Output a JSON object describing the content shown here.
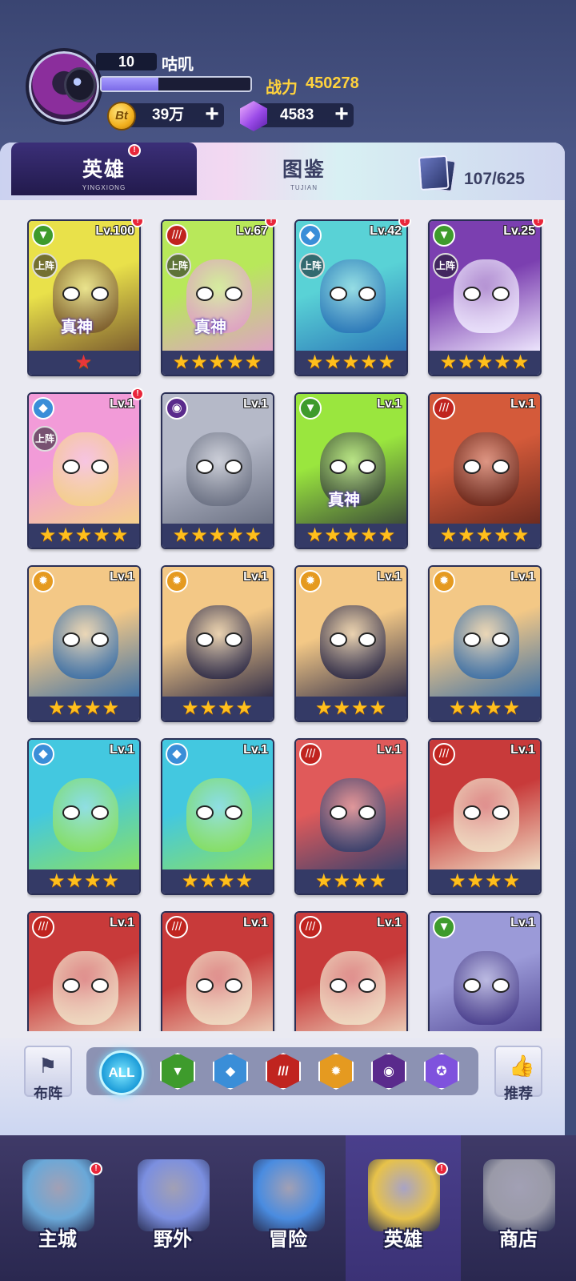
{
  "player": {
    "level": "10",
    "name": "咕叽",
    "xp_fraction": 0.38,
    "power_label": "战力",
    "power_value": "450278",
    "coins": "39万",
    "gems": "4583",
    "coin_icon_text": "Bt"
  },
  "tabs": {
    "heroes_title": "英雄",
    "heroes_sub": "YINGXIONG",
    "atlas_title": "图鉴",
    "atlas_sub": "TUJIAN",
    "collection": "107/625"
  },
  "badges": {
    "alert": "!"
  },
  "labels": {
    "deployed": "上阵",
    "true_god": "真神"
  },
  "heroes": [
    {
      "level": "Lv.100",
      "faction": "green",
      "stars": "★",
      "deployed": true,
      "true_god": true,
      "alert": true,
      "bg": [
        "#e9e14a",
        "#7a5a2e"
      ]
    },
    {
      "level": "Lv.67",
      "faction": "red",
      "stars": "★★★★★",
      "deployed": true,
      "true_god": true,
      "alert": true,
      "bg": [
        "#b8e85a",
        "#e0a0c8"
      ]
    },
    {
      "level": "Lv.42",
      "faction": "blue",
      "stars": "★★★★★",
      "deployed": true,
      "true_god": false,
      "alert": true,
      "bg": [
        "#59d2d6",
        "#2c76b8"
      ]
    },
    {
      "level": "Lv.25",
      "faction": "green",
      "stars": "★★★★★",
      "deployed": true,
      "true_god": false,
      "alert": true,
      "bg": [
        "#7b3fb0",
        "#f0eaff"
      ]
    },
    {
      "level": "Lv.1",
      "faction": "blue",
      "stars": "★★★★★",
      "deployed": true,
      "true_god": false,
      "alert": true,
      "bg": [
        "#f29bd8",
        "#f4d28a"
      ]
    },
    {
      "level": "Lv.1",
      "faction": "purple",
      "stars": "★★★★★",
      "deployed": false,
      "true_god": false,
      "alert": false,
      "bg": [
        "#b5b9c8",
        "#6a7082"
      ]
    },
    {
      "level": "Lv.1",
      "faction": "green",
      "stars": "★★★★★",
      "deployed": false,
      "true_god": true,
      "alert": false,
      "bg": [
        "#9ae63e",
        "#3b4a38"
      ]
    },
    {
      "level": "Lv.1",
      "faction": "red",
      "stars": "★★★★★",
      "deployed": false,
      "true_god": false,
      "alert": false,
      "bg": [
        "#d45a3a",
        "#6b2a1e"
      ]
    },
    {
      "level": "Lv.1",
      "faction": "orange",
      "stars": "★★★★",
      "deployed": false,
      "true_god": false,
      "alert": false,
      "bg": [
        "#f3c886",
        "#3a6fa8"
      ]
    },
    {
      "level": "Lv.1",
      "faction": "orange",
      "stars": "★★★★",
      "deployed": false,
      "true_god": false,
      "alert": false,
      "bg": [
        "#f3c886",
        "#2c2a48"
      ]
    },
    {
      "level": "Lv.1",
      "faction": "orange",
      "stars": "★★★★",
      "deployed": false,
      "true_god": false,
      "alert": false,
      "bg": [
        "#f3c886",
        "#2c2a48"
      ]
    },
    {
      "level": "Lv.1",
      "faction": "orange",
      "stars": "★★★★",
      "deployed": false,
      "true_god": false,
      "alert": false,
      "bg": [
        "#f3c886",
        "#3a6fa8"
      ]
    },
    {
      "level": "Lv.1",
      "faction": "blue",
      "stars": "★★★★",
      "deployed": false,
      "true_god": false,
      "alert": false,
      "bg": [
        "#43c8e0",
        "#8be060"
      ]
    },
    {
      "level": "Lv.1",
      "faction": "blue",
      "stars": "★★★★",
      "deployed": false,
      "true_god": false,
      "alert": false,
      "bg": [
        "#43c8e0",
        "#8be060"
      ]
    },
    {
      "level": "Lv.1",
      "faction": "red",
      "stars": "★★★★",
      "deployed": false,
      "true_god": false,
      "alert": false,
      "bg": [
        "#e05a5a",
        "#34416e"
      ]
    },
    {
      "level": "Lv.1",
      "faction": "red",
      "stars": "★★★★",
      "deployed": false,
      "true_god": false,
      "alert": false,
      "bg": [
        "#c83a3a",
        "#f1e2c8"
      ]
    },
    {
      "level": "Lv.1",
      "faction": "red",
      "stars": "",
      "deployed": false,
      "true_god": false,
      "alert": false,
      "bg": [
        "#c83a3a",
        "#f1e2c8"
      ]
    },
    {
      "level": "Lv.1",
      "faction": "red",
      "stars": "",
      "deployed": false,
      "true_god": false,
      "alert": false,
      "bg": [
        "#c83a3a",
        "#f1e2c8"
      ]
    },
    {
      "level": "Lv.1",
      "faction": "red",
      "stars": "",
      "deployed": false,
      "true_god": false,
      "alert": false,
      "bg": [
        "#c83a3a",
        "#f1e2c8"
      ]
    },
    {
      "level": "Lv.1",
      "faction": "green",
      "stars": "",
      "deployed": false,
      "true_god": false,
      "alert": false,
      "bg": [
        "#9b9ad8",
        "#4a3f8c"
      ]
    }
  ],
  "filter": {
    "left_label": "布阵",
    "right_label": "推荐",
    "all_label": "ALL",
    "factions": [
      {
        "name": "green",
        "color": "#3e9b2c",
        "icon": "leaf-icon",
        "glyph": "▼"
      },
      {
        "name": "blue",
        "color": "#3a8ed8",
        "icon": "water-drop-icon",
        "glyph": "◆"
      },
      {
        "name": "red",
        "color": "#c0241f",
        "icon": "claw-icon",
        "glyph": "///"
      },
      {
        "name": "orange",
        "color": "#e59a20",
        "icon": "sun-icon",
        "glyph": "✹"
      },
      {
        "name": "purple",
        "color": "#5a2a8c",
        "icon": "eye-icon",
        "glyph": "◉"
      },
      {
        "name": "violet",
        "color": "#7f52dd",
        "icon": "spiral-icon",
        "glyph": "✪"
      }
    ]
  },
  "nav": [
    {
      "label": "主城",
      "icon": "city-icon",
      "alert": true,
      "active": false,
      "color": "#6aa8d8"
    },
    {
      "label": "野外",
      "icon": "field-icon",
      "alert": false,
      "active": false,
      "color": "#7b8fe0"
    },
    {
      "label": "冒险",
      "icon": "adventure-icon",
      "alert": false,
      "active": false,
      "color": "#4a8ce0"
    },
    {
      "label": "英雄",
      "icon": "hero-icon",
      "alert": true,
      "active": true,
      "color": "#e7c24a"
    },
    {
      "label": "商店",
      "icon": "shop-icon",
      "alert": false,
      "active": false,
      "color": "#9a9aa8"
    }
  ]
}
